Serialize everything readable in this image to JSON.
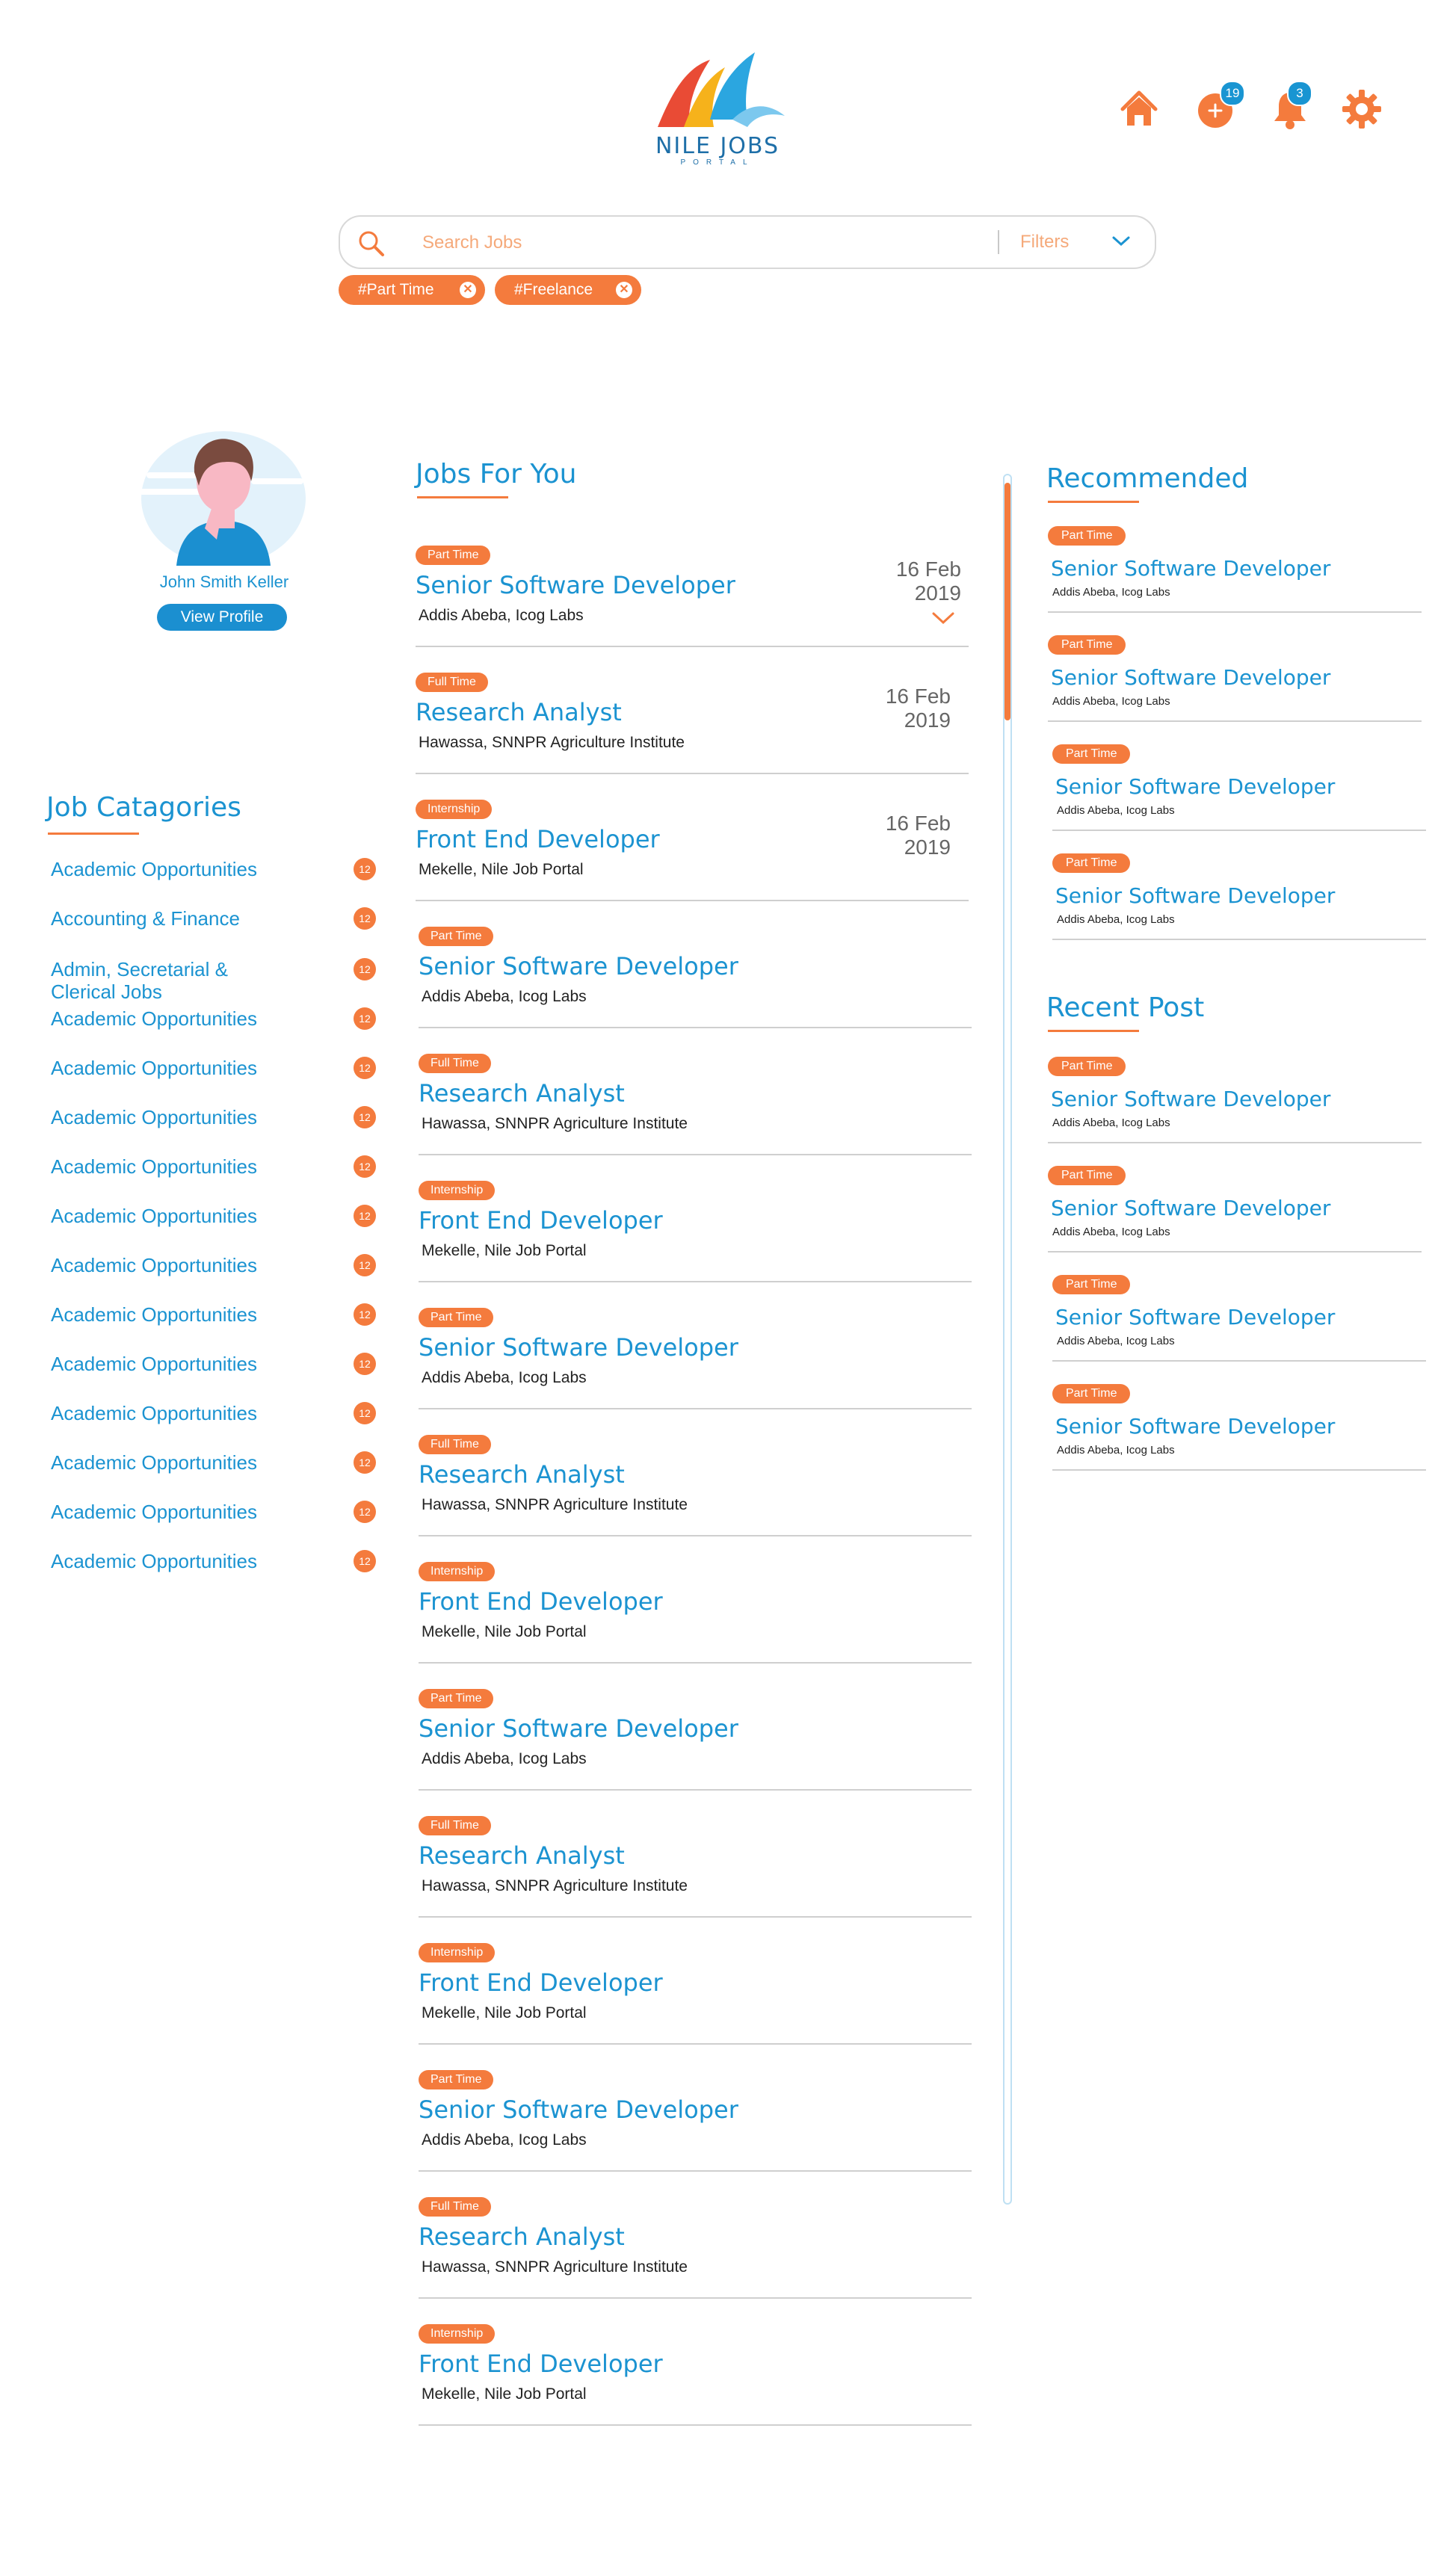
{
  "header": {
    "logo_text": "NILE JOBS",
    "logo_sub": "PORTAL",
    "add_badge": "19",
    "notif_badge": "3"
  },
  "search": {
    "placeholder": "Search Jobs",
    "filters_label": "Filters"
  },
  "active_filters": [
    "#Part Time",
    "#Freelance"
  ],
  "profile": {
    "name": "John Smith Keller",
    "view_profile": "View Profile"
  },
  "categories": {
    "title": "Job Catagories",
    "items": [
      {
        "label": "Academic Opportunities",
        "count": "12"
      },
      {
        "label": "Accounting & Finance",
        "count": "12"
      },
      {
        "label": "Admin, Secretarial &",
        "label2": "Clerical Jobs",
        "count": "12"
      },
      {
        "label": "Academic Opportunities",
        "count": "12"
      },
      {
        "label": "Academic Opportunities",
        "count": "12"
      },
      {
        "label": "Academic Opportunities",
        "count": "12"
      },
      {
        "label": "Academic Opportunities",
        "count": "12"
      },
      {
        "label": "Academic Opportunities",
        "count": "12"
      },
      {
        "label": "Academic Opportunities",
        "count": "12"
      },
      {
        "label": "Academic Opportunities",
        "count": "12"
      },
      {
        "label": "Academic Opportunities",
        "count": "12"
      },
      {
        "label": "Academic Opportunities",
        "count": "12"
      },
      {
        "label": "Academic Opportunities",
        "count": "12"
      },
      {
        "label": "Academic Opportunities",
        "count": "12"
      },
      {
        "label": "Academic Opportunities",
        "count": "12"
      }
    ]
  },
  "jobs": {
    "title": "Jobs For You",
    "items": [
      {
        "type": "Part Time",
        "title": "Senior Software Developer",
        "location": "Addis Abeba, Icog Labs",
        "date1": "16 Feb",
        "date2": "2019"
      },
      {
        "type": "Full Time",
        "title": "Research Analyst",
        "location": "Hawassa, SNNPR Agriculture Institute",
        "date1": "16 Feb",
        "date2": "2019"
      },
      {
        "type": "Internship",
        "title": "Front End Developer",
        "location": "Mekelle, Nile Job Portal",
        "date1": "16 Feb",
        "date2": "2019"
      },
      {
        "type": "Part Time",
        "title": "Senior Software Developer",
        "location": "Addis Abeba, Icog Labs"
      },
      {
        "type": "Full Time",
        "title": "Research Analyst",
        "location": "Hawassa, SNNPR Agriculture Institute"
      },
      {
        "type": "Internship",
        "title": "Front End Developer",
        "location": "Mekelle, Nile Job Portal"
      },
      {
        "type": "Part Time",
        "title": "Senior Software Developer",
        "location": "Addis Abeba, Icog Labs"
      },
      {
        "type": "Full Time",
        "title": "Research Analyst",
        "location": "Hawassa, SNNPR Agriculture Institute"
      },
      {
        "type": "Internship",
        "title": "Front End Developer",
        "location": "Mekelle, Nile Job Portal"
      },
      {
        "type": "Part Time",
        "title": "Senior Software Developer",
        "location": "Addis Abeba, Icog Labs"
      },
      {
        "type": "Full Time",
        "title": "Research Analyst",
        "location": "Hawassa, SNNPR Agriculture Institute"
      },
      {
        "type": "Internship",
        "title": "Front End Developer",
        "location": "Mekelle, Nile Job Portal"
      },
      {
        "type": "Part Time",
        "title": "Senior Software Developer",
        "location": "Addis Abeba, Icog Labs"
      },
      {
        "type": "Full Time",
        "title": "Research Analyst",
        "location": "Hawassa, SNNPR Agriculture Institute"
      },
      {
        "type": "Internship",
        "title": "Front End Developer",
        "location": "Mekelle, Nile Job Portal"
      }
    ]
  },
  "recommended": {
    "title": "Recommended",
    "items": [
      {
        "type": "Part Time",
        "title": "Senior Software Developer",
        "location": "Addis Abeba, Icog Labs"
      },
      {
        "type": "Part Time",
        "title": "Senior Software Developer",
        "location": "Addis Abeba, Icog Labs"
      },
      {
        "type": "Part Time",
        "title": "Senior Software Developer",
        "location": "Addis Abeba, Icog Labs"
      },
      {
        "type": "Part Time",
        "title": "Senior Software Developer",
        "location": "Addis Abeba, Icog Labs"
      }
    ]
  },
  "recent": {
    "title": "Recent Post",
    "items": [
      {
        "type": "Part Time",
        "title": "Senior Software Developer",
        "location": "Addis Abeba, Icog Labs"
      },
      {
        "type": "Part Time",
        "title": "Senior Software Developer",
        "location": "Addis Abeba, Icog Labs"
      },
      {
        "type": "Part Time",
        "title": "Senior Software Developer",
        "location": "Addis Abeba, Icog Labs"
      },
      {
        "type": "Part Time",
        "title": "Senior Software Developer",
        "location": "Addis Abeba, Icog Labs"
      }
    ]
  },
  "colors": {
    "accent": "#f47b3d",
    "primary": "#1b93d1"
  }
}
